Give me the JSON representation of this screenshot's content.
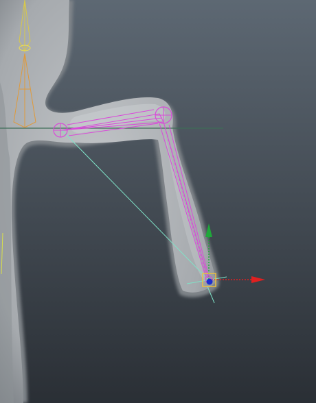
{
  "viewport": {
    "panel": "3d-perspective-viewport",
    "background_top_color": "#5d6873",
    "background_bottom_color": "#2a2f35"
  },
  "scene": {
    "mesh": {
      "name": "character-arm-mesh",
      "shading": "smooth-shaded",
      "color": "#a9adb1",
      "edge_color": "#8c9196"
    },
    "skeleton": {
      "joint_color": "#d94ad9",
      "spine_color": "#e09a3a",
      "highlight_color": "#f2e04a",
      "joints": [
        "shoulder-joint",
        "elbow-joint",
        "wrist-joint"
      ]
    },
    "ik_handle": {
      "pole_vector_color": "#7fe3c8",
      "selected_color": "#f2c23a"
    },
    "grid": {
      "horizon_line_color": "#3f6e58"
    }
  },
  "move_manipulator": {
    "tool": "move-tool",
    "x_axis_color": "#e02020",
    "y_axis_color": "#1fa83a",
    "z_axis_color": "#1c2fd0",
    "center_color": "#f2c23a"
  }
}
